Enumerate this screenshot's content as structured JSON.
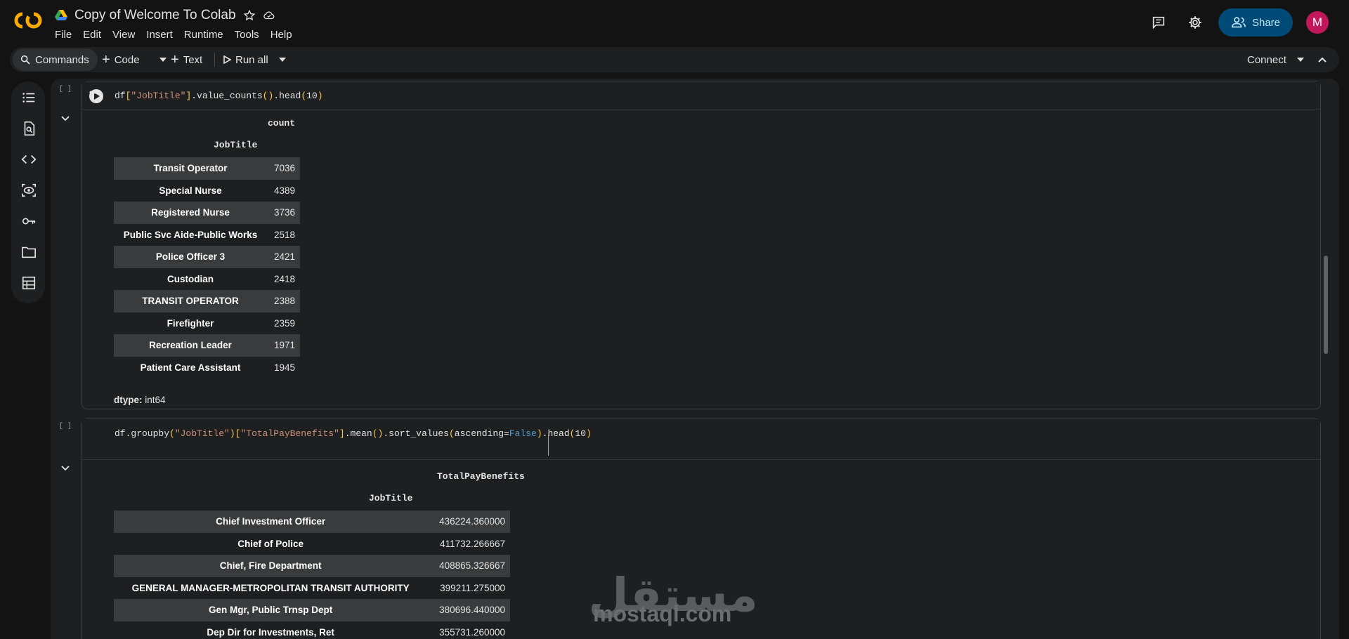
{
  "header": {
    "doc_title": "Copy of Welcome To Colab",
    "menu": [
      "File",
      "Edit",
      "View",
      "Insert",
      "Runtime",
      "Tools",
      "Help"
    ],
    "share_label": "Share",
    "avatar_letter": "M"
  },
  "toolbar": {
    "commands": "Commands",
    "code": "Code",
    "text": "Text",
    "run_all": "Run all",
    "connect": "Connect"
  },
  "cells": [
    {
      "exec_count": "[ ]",
      "code_parts": [
        "df",
        "[",
        "\"JobTitle\"",
        "]",
        ".value_counts",
        "(",
        ")",
        ".head",
        "(",
        "10",
        ")"
      ],
      "output": {
        "value_header": "count",
        "index_header": "JobTitle",
        "rows": [
          {
            "label": "Transit Operator",
            "value": "7036"
          },
          {
            "label": "Special Nurse",
            "value": "4389"
          },
          {
            "label": "Registered Nurse",
            "value": "3736"
          },
          {
            "label": "Public Svc Aide-Public Works",
            "value": "2518"
          },
          {
            "label": "Police Officer 3",
            "value": "2421"
          },
          {
            "label": "Custodian",
            "value": "2418"
          },
          {
            "label": "TRANSIT OPERATOR",
            "value": "2388"
          },
          {
            "label": "Firefighter",
            "value": "2359"
          },
          {
            "label": "Recreation Leader",
            "value": "1971"
          },
          {
            "label": "Patient Care Assistant",
            "value": "1945"
          }
        ],
        "dtype_label": "dtype:",
        "dtype_value": "int64"
      }
    },
    {
      "exec_count": "[ ]",
      "code_parts": [
        "df.groupby",
        "(",
        "\"JobTitle\"",
        ")",
        "[",
        "\"TotalPayBenefits\"",
        "]",
        ".mean",
        "(",
        ")",
        ".sort_values",
        "(",
        "ascending=",
        "False",
        ")",
        ".head",
        "(",
        "10",
        ")"
      ],
      "output": {
        "value_header": "TotalPayBenefits",
        "index_header": "JobTitle",
        "rows": [
          {
            "label": "Chief Investment Officer",
            "value": "436224.360000"
          },
          {
            "label": "Chief of Police",
            "value": "411732.266667"
          },
          {
            "label": "Chief, Fire Department",
            "value": "408865.326667"
          },
          {
            "label": "GENERAL MANAGER-METROPOLITAN TRANSIT AUTHORITY",
            "value": "399211.275000"
          },
          {
            "label": "Gen Mgr, Public Trnsp Dept",
            "value": "380696.440000"
          },
          {
            "label": "Dep Dir for Investments, Ret",
            "value": "355731.260000"
          }
        ]
      }
    }
  ],
  "watermark": {
    "arabic": "مستقل",
    "latin": "mostaql.com"
  }
}
